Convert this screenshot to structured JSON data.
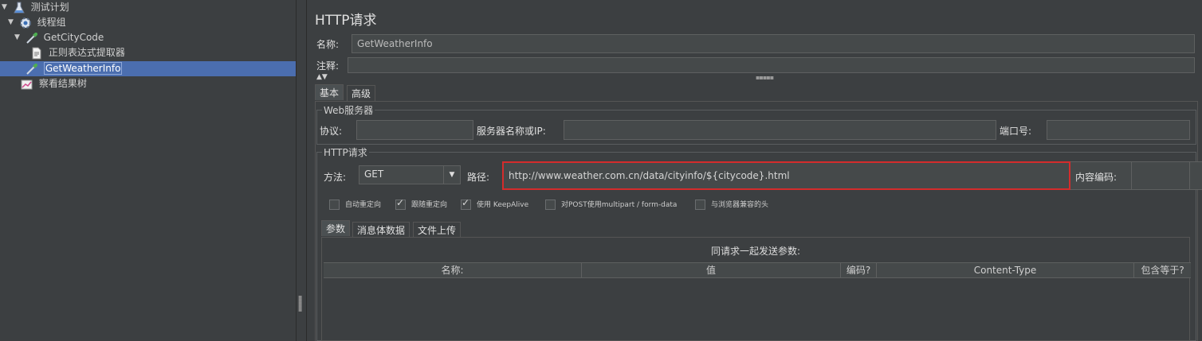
{
  "tree": {
    "items": [
      {
        "label": "测试计划",
        "expanded": true
      },
      {
        "label": "线程组",
        "expanded": true
      },
      {
        "label": "GetCityCode",
        "expanded": true
      },
      {
        "label": "正则表达式提取器"
      },
      {
        "label": "GetWeatherInfo",
        "selected": true
      },
      {
        "label": "察看结果树"
      }
    ]
  },
  "panel": {
    "title": "HTTP请求",
    "name_label": "名称:",
    "name_value": "GetWeatherInfo",
    "comment_label": "注释:",
    "tabs": [
      {
        "label": "基本",
        "active": true
      },
      {
        "label": "高级"
      }
    ],
    "web_server": {
      "group_title": "Web服务器",
      "protocol_label": "协议:",
      "protocol_value": "",
      "server_label": "服务器名称或IP:",
      "server_value": "",
      "port_label": "端口号:",
      "port_value": ""
    },
    "http_request": {
      "group_title": "HTTP请求",
      "method_label": "方法:",
      "method_value": "GET",
      "path_label": "路径:",
      "path_value": "http://www.weather.com.cn/data/cityinfo/${citycode}.html",
      "encoding_label": "内容编码:",
      "encoding_value": ""
    },
    "checkboxes": [
      {
        "label": "自动重定向",
        "checked": false
      },
      {
        "label": "跟随重定向",
        "checked": true
      },
      {
        "label": "使用 KeepAlive",
        "checked": true
      },
      {
        "label": "对POST使用multipart / form-data",
        "checked": false
      },
      {
        "label": "与浏览器兼容的头",
        "checked": false
      }
    ],
    "sub_tabs": [
      {
        "label": "参数",
        "active": true
      },
      {
        "label": "消息体数据"
      },
      {
        "label": "文件上传"
      }
    ],
    "params": {
      "title": "同请求一起发送参数:",
      "columns": [
        "名称:",
        "值",
        "编码?",
        "Content-Type",
        "包含等于?"
      ]
    }
  },
  "colors": {
    "background": "#3c3f41",
    "selection": "#4b6eaf",
    "highlight_border": "#d42c2c"
  },
  "icons": [
    "flask-icon",
    "gear-icon",
    "pipette-icon",
    "document-icon",
    "pipette-icon",
    "chart-icon"
  ]
}
